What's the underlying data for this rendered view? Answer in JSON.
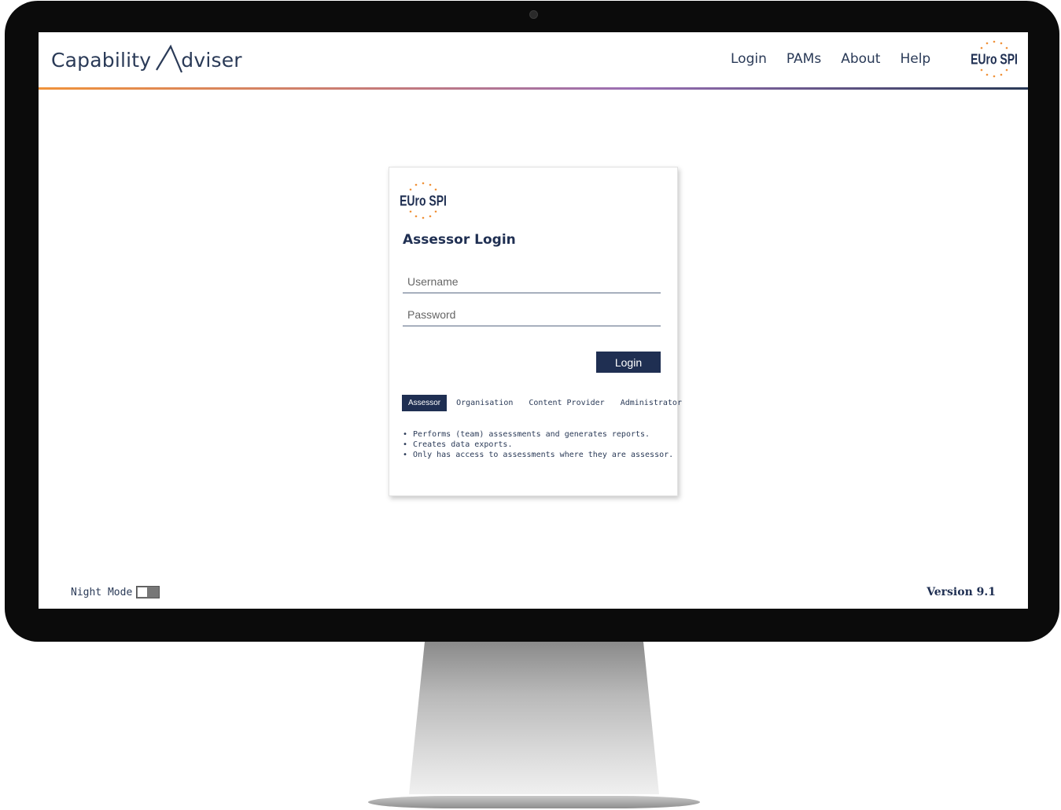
{
  "header": {
    "brand": "Capability  dviser",
    "brand_prefix": "Capability",
    "brand_suffix": "dviser",
    "nav": [
      "Login",
      "PAMs",
      "About",
      "Help"
    ],
    "logo_text": "EUro SPI"
  },
  "login_card": {
    "logo_text": "EUro SPI",
    "title": "Assessor Login",
    "username_placeholder": "Username",
    "password_placeholder": "Password",
    "login_button": "Login",
    "roles": [
      "Assessor",
      "Organisation",
      "Content Provider",
      "Administrator"
    ],
    "active_role": "Assessor",
    "description": [
      "Performs (team) assessments and generates reports.",
      "Creates data exports.",
      "Only has access to assessments where they are assessor."
    ]
  },
  "footer": {
    "night_mode_label": "Night Mode",
    "night_mode_on": false,
    "version": "Version 9.1"
  },
  "colors": {
    "navy": "#1f2f52",
    "accent_orange": "#f0923a",
    "accent_purple": "#9a6fb4"
  }
}
